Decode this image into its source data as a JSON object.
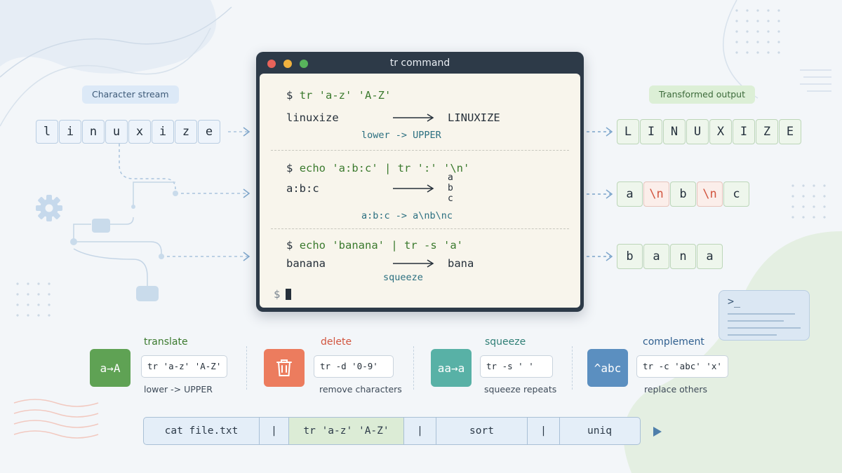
{
  "labels": {
    "input_stream": "Character stream",
    "output_stream": "Transformed output"
  },
  "input_chars": [
    "l",
    "i",
    "n",
    "u",
    "x",
    "i",
    "z",
    "e"
  ],
  "terminal": {
    "title": "tr command",
    "prompt": "$",
    "examples": [
      {
        "command": "tr 'a-z' 'A-Z'",
        "input": "linuxize",
        "output": "LINUXIZE",
        "note": "lower -> UPPER"
      },
      {
        "command": "echo 'a:b:c' | tr ':' '\\n'",
        "input": "a:b:c",
        "output_lines": [
          "a",
          "b",
          "c"
        ],
        "note": "a:b:c -> a\\nb\\nc"
      },
      {
        "command": "echo 'banana' | tr -s 'a'",
        "input": "banana",
        "output": "bana",
        "note": "squeeze"
      }
    ]
  },
  "outputs": {
    "row1": [
      "L",
      "I",
      "N",
      "U",
      "X",
      "I",
      "Z",
      "E"
    ],
    "row2": [
      "a",
      "\\n",
      "b",
      "\\n",
      "c"
    ],
    "row3": [
      "b",
      "a",
      "n",
      "a"
    ]
  },
  "operations": [
    {
      "icon_text": "a→A",
      "title": "translate",
      "code": "tr 'a-z' 'A-Z'",
      "desc": "lower -> UPPER",
      "color": "#5fa254",
      "title_color": "#3b7a2e"
    },
    {
      "icon_text": "trash-icon",
      "title": "delete",
      "code": "tr -d '0-9'",
      "desc": "remove characters",
      "color": "#ec7c5e",
      "title_color": "#d2553f"
    },
    {
      "icon_text": "aa→a",
      "title": "squeeze",
      "code": "tr -s ' '",
      "desc": "squeeze repeats",
      "color": "#58b1a6",
      "title_color": "#2f7f76"
    },
    {
      "icon_text": "^abc",
      "title": "complement",
      "code": "tr -c 'abc' 'x'",
      "desc": "replace others",
      "color": "#5b8fc0",
      "title_color": "#2f5f8f"
    }
  ],
  "pipeline": [
    "cat file.txt",
    "|",
    "tr 'a-z' 'A-Z'",
    "|",
    "sort",
    "|",
    "uniq"
  ],
  "colors": {
    "terminal_frame": "#2d3a48",
    "terminal_body": "#f8f5ec",
    "command_green": "#3b7a2e",
    "note_teal": "#2b6f80",
    "newline_red": "#d2553f"
  }
}
